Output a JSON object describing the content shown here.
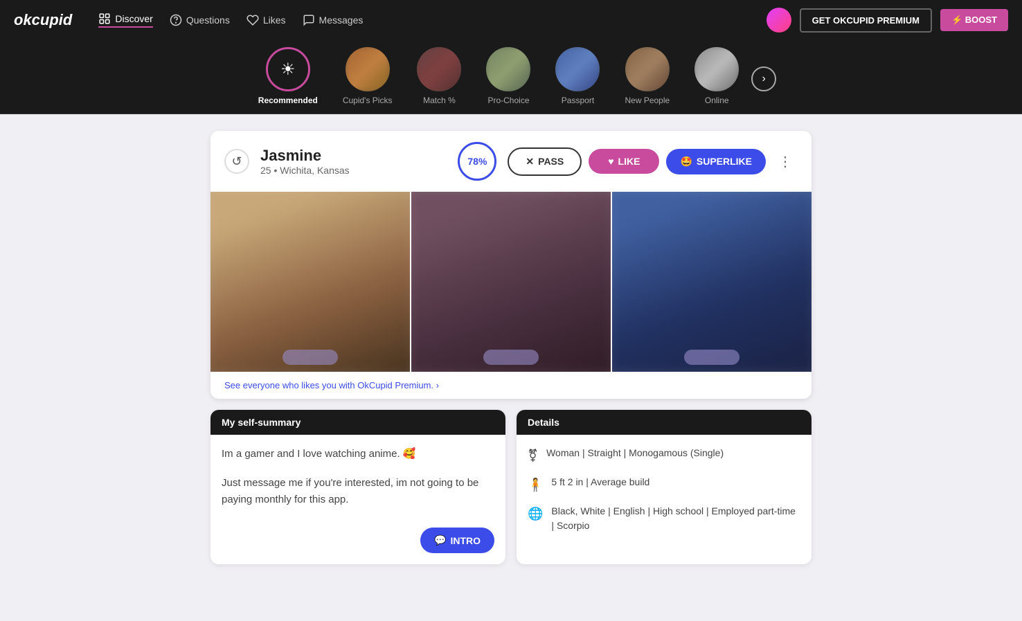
{
  "app": {
    "logo": "okcupid",
    "nav": [
      {
        "id": "discover",
        "label": "Discover",
        "active": true
      },
      {
        "id": "questions",
        "label": "Questions",
        "active": false
      },
      {
        "id": "likes",
        "label": "Likes",
        "active": false
      },
      {
        "id": "messages",
        "label": "Messages",
        "active": false
      }
    ],
    "header_right": {
      "premium_label": "GET OKCUPID PREMIUM",
      "boost_label": "⚡ BOOST"
    }
  },
  "categories": [
    {
      "id": "recommended",
      "label": "Recommended",
      "active": true,
      "is_recommended": true
    },
    {
      "id": "cupids_picks",
      "label": "Cupid's Picks",
      "active": false
    },
    {
      "id": "match_pct",
      "label": "Match %",
      "active": false
    },
    {
      "id": "pro_choice",
      "label": "Pro-Choice",
      "active": false
    },
    {
      "id": "passport",
      "label": "Passport",
      "active": false
    },
    {
      "id": "new_people",
      "label": "New People",
      "active": false
    },
    {
      "id": "online",
      "label": "Online",
      "active": false
    }
  ],
  "profile": {
    "name": "Jasmine",
    "age": "25",
    "location": "Wichita, Kansas",
    "match_pct": "78%",
    "actions": {
      "pass": "PASS",
      "like": "LIKE",
      "superlike": "SUPERLIKE"
    },
    "premium_link": "See everyone who likes you with OkCupid Premium.",
    "self_summary": {
      "header": "My self-summary",
      "text1": "Im a gamer and I love watching anime. 🥰",
      "text2": "Just message me if you're interested, im not going to be paying monthly for this app.",
      "intro_btn": "INTRO"
    },
    "details": {
      "header": "Details",
      "row1": "Woman | Straight | Monogamous (Single)",
      "row2": "5 ft 2 in | Average build",
      "row3": "Black, White | English | High school | Employed part-time | Scorpio"
    }
  }
}
